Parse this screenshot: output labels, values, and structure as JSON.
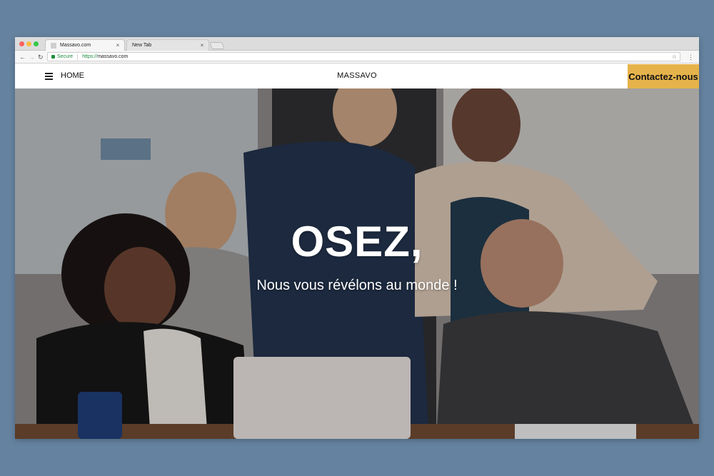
{
  "browser": {
    "tabs": [
      {
        "title": "Massavo.com",
        "active": true
      },
      {
        "title": "New Tab",
        "active": false
      }
    ],
    "address": {
      "secure_label": "Secure",
      "url_scheme": "https://",
      "url_host": "massavo.com"
    },
    "icons": [
      "back-icon",
      "forward-icon",
      "reload-icon",
      "lock-icon",
      "star-icon",
      "menu-kebab-icon",
      "close-icon"
    ]
  },
  "header": {
    "home_label": "HOME",
    "brand": "MASSAVO",
    "cta_label": "Contactez-nous",
    "cta_color": "#e6b34b"
  },
  "hero": {
    "title": "OSEZ,",
    "subtitle": "Nous vous révélons au monde !"
  },
  "colors": {
    "page_background": "#6583a0",
    "accent": "#e6b34b"
  }
}
